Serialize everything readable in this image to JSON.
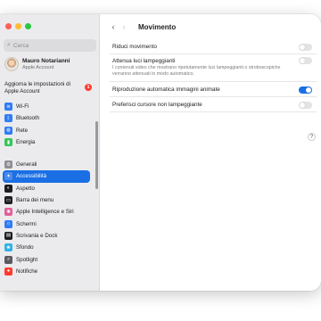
{
  "sidebar": {
    "search_placeholder": "Cerca",
    "account": {
      "name": "Mauro Notarianni",
      "subtitle": "Apple Account"
    },
    "update": {
      "label": "Aggiorna le impostazioni di Apple Account",
      "badge": "1"
    },
    "group1": [
      {
        "label": "Wi-Fi",
        "icon": "wifi-icon",
        "color": "#2f7cf6",
        "glyph": "≋"
      },
      {
        "label": "Bluetooth",
        "icon": "bluetooth-icon",
        "color": "#2f7cf6",
        "glyph": "ᛒ"
      },
      {
        "label": "Rete",
        "icon": "globe-icon",
        "color": "#2f7cf6",
        "glyph": "◍"
      },
      {
        "label": "Energia",
        "icon": "battery-icon",
        "color": "#34c759",
        "glyph": "▮"
      }
    ],
    "group2": [
      {
        "label": "Generali",
        "icon": "gear-icon",
        "color": "#8e8e93",
        "glyph": "⚙",
        "selected": false
      },
      {
        "label": "Accessibilità",
        "icon": "accessibility-icon",
        "color": "#1a6fe5",
        "glyph": "✦",
        "selected": true
      },
      {
        "label": "Aspetto",
        "icon": "appearance-icon",
        "color": "#1d1d1f",
        "glyph": "◐",
        "selected": false
      },
      {
        "label": "Barra dei menu",
        "icon": "menu-bar-icon",
        "color": "#1d1d1f",
        "glyph": "▭",
        "selected": false
      },
      {
        "label": "Apple Intelligence e Siri",
        "icon": "siri-icon",
        "color": "#e0609a",
        "glyph": "✺",
        "selected": false
      },
      {
        "label": "Schermi",
        "icon": "display-icon",
        "color": "#2f7cf6",
        "glyph": "☼",
        "selected": false
      },
      {
        "label": "Scrivania e Dock",
        "icon": "dock-icon",
        "color": "#1d1d1f",
        "glyph": "▤",
        "selected": false
      },
      {
        "label": "Sfondo",
        "icon": "wallpaper-icon",
        "color": "#30b0e8",
        "glyph": "❀",
        "selected": false
      },
      {
        "label": "Spotlight",
        "icon": "spotlight-icon",
        "color": "#5a5a5f",
        "glyph": "⌕",
        "selected": false
      },
      {
        "label": "Notifiche",
        "icon": "notifications-icon",
        "color": "#ff3b30",
        "glyph": "●",
        "selected": false
      }
    ]
  },
  "main": {
    "title": "Movimento",
    "back_icon": "chevron-left-icon",
    "forward_icon": "chevron-right-icon",
    "settings": [
      {
        "label": "Riduci movimento",
        "description": "",
        "on": false
      },
      {
        "label": "Attenua luci lampeggianti",
        "description": "I contenuti video che mostrano ripetutamente luci lampeggianti o stroboscopiche verranno attenuati in modo automatico.",
        "on": false
      },
      {
        "label": "Riproduzione automatica immagini animate",
        "description": "",
        "on": true
      },
      {
        "label": "Preferisci cursore non lampeggiante",
        "description": "",
        "on": false
      }
    ],
    "help": "?"
  }
}
